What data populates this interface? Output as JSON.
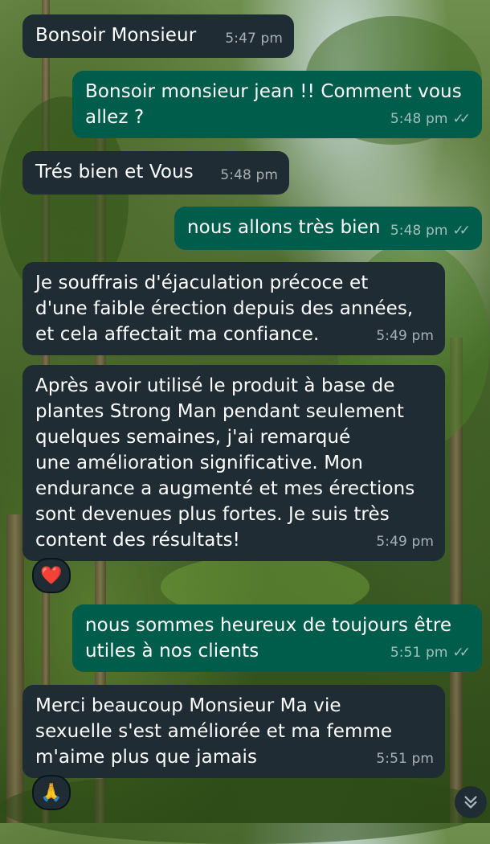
{
  "messages": [
    {
      "dir": "in",
      "text": "Bonsoir Monsieur",
      "time": "5:47 pm"
    },
    {
      "dir": "out",
      "text": "Bonsoir monsieur jean !! Comment vous\nallez ?",
      "time": "5:48 pm",
      "status": "read"
    },
    {
      "dir": "in",
      "text": "Trés bien et Vous",
      "time": "5:48 pm"
    },
    {
      "dir": "out",
      "text": "nous allons très bien",
      "time": "5:48 pm",
      "status": "read"
    },
    {
      "dir": "in",
      "text": "Je souffrais d'éjaculation précoce et\nd'une faible érection depuis des années,\net cela affectait ma confiance.",
      "time": "5:49 pm"
    },
    {
      "dir": "in",
      "text": "Après avoir utilisé le produit à base de\nplantes Strong Man pendant seulement\nquelques semaines, j'ai remarqué\nune amélioration significative. Mon\nendurance a augmenté et mes érections\nsont devenues plus fortes. Je suis très\ncontent des résultats!",
      "time": "5:49 pm",
      "reaction": "❤️"
    },
    {
      "dir": "out",
      "text": "nous sommes heureux de toujours être\nutiles à nos clients",
      "time": "5:51 pm",
      "status": "read"
    },
    {
      "dir": "in",
      "text": "Merci beaucoup Monsieur Ma vie\nsexuelle s'est améliorée et ma femme\nm'aime plus que jamais",
      "time": "5:51 pm",
      "reaction": "🙏"
    }
  ],
  "icons": {
    "read_receipt": "double-check-icon",
    "scroll_down": "double-chevron-down-icon"
  },
  "colors": {
    "incoming_bubble": "#1f2c34",
    "outgoing_bubble": "#005c4b"
  }
}
